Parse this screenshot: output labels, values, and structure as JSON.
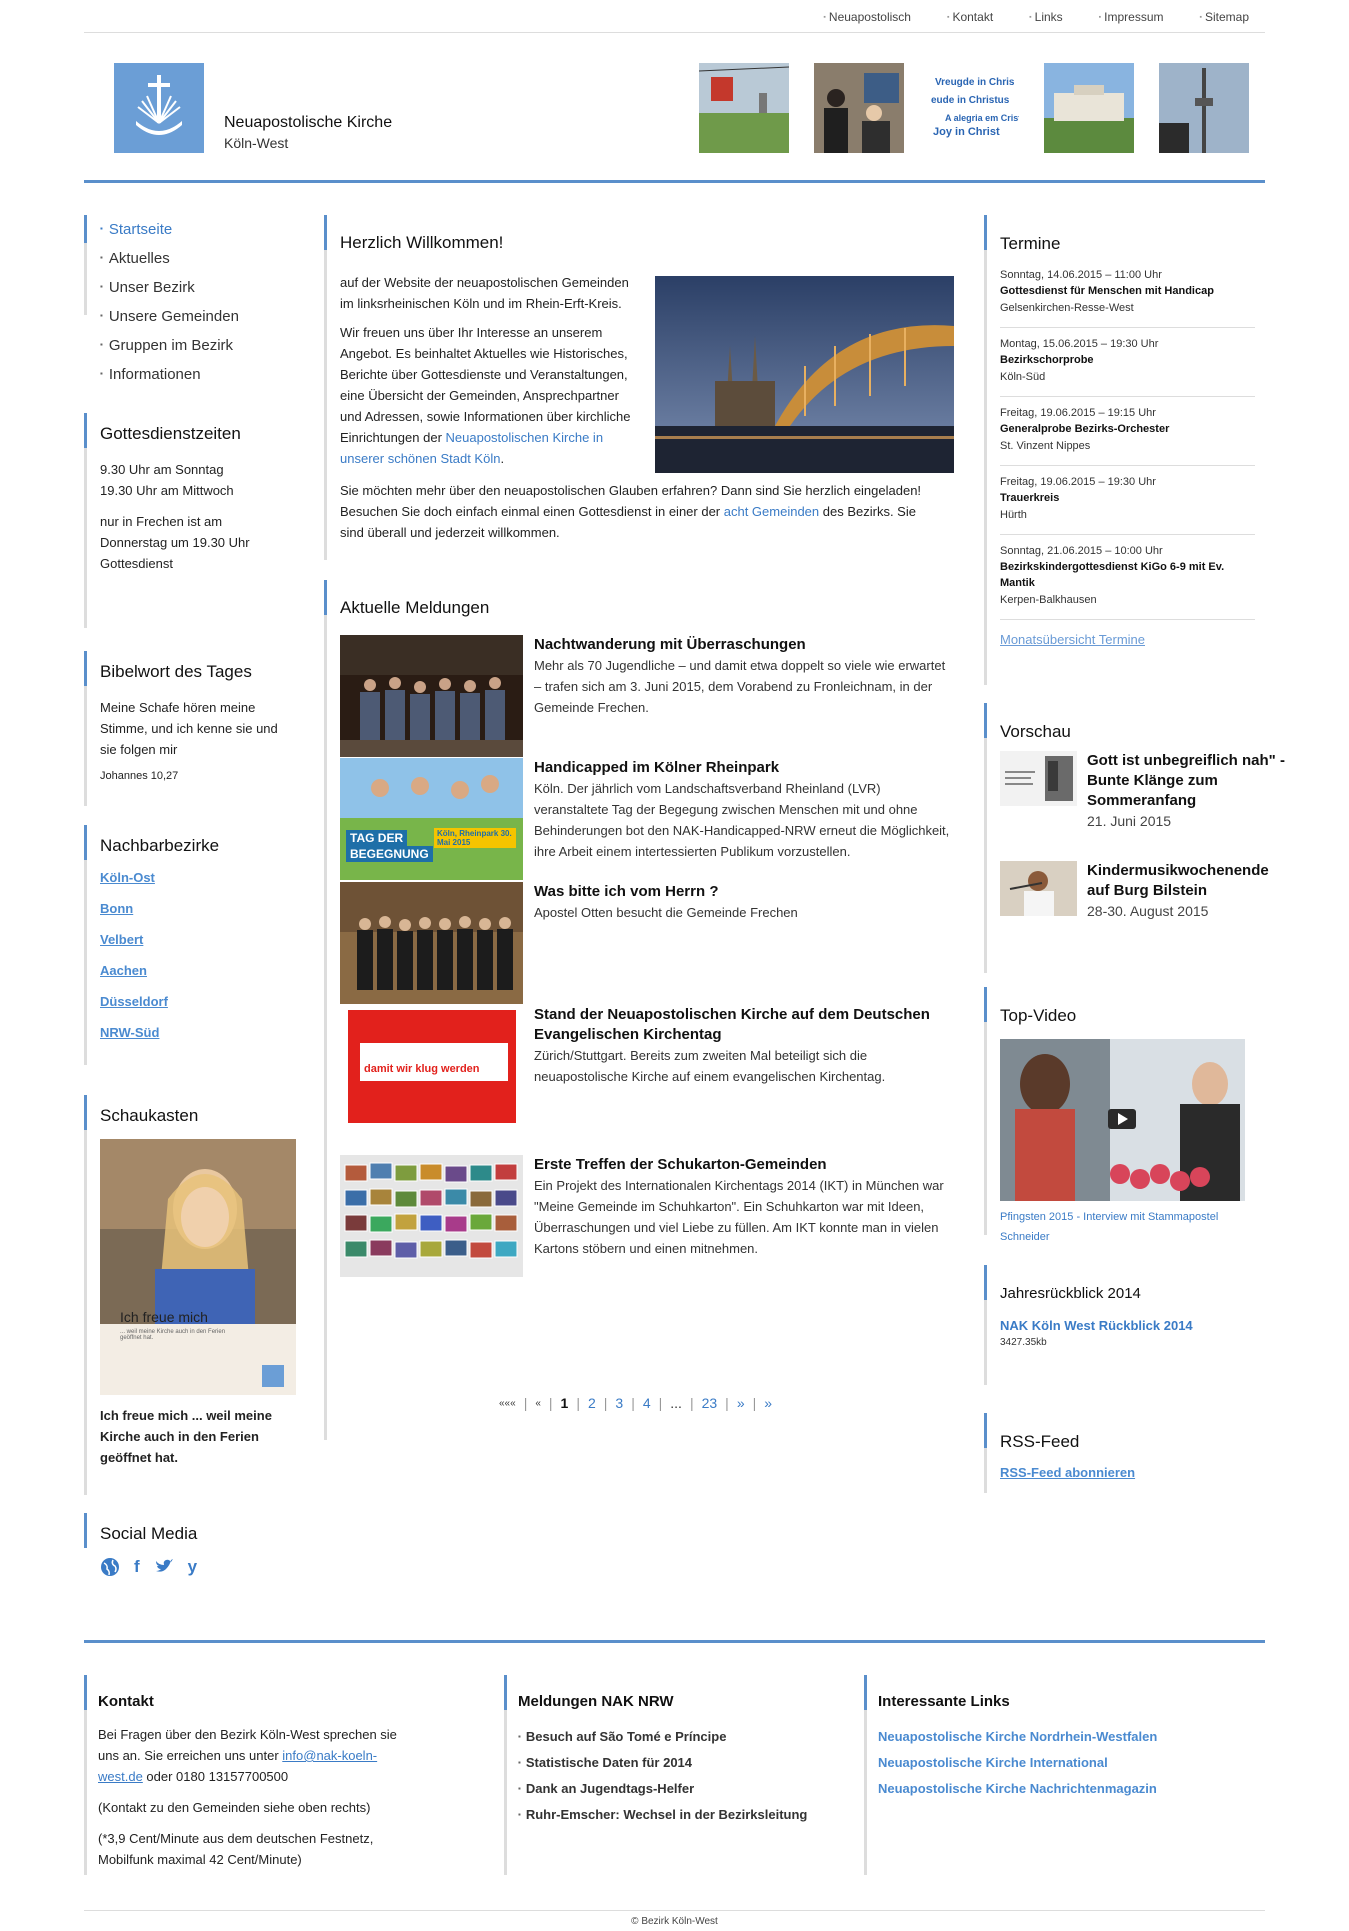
{
  "topnav": [
    "Neuapostolisch",
    "Kontakt",
    "Links",
    "Impressum",
    "Sitemap"
  ],
  "brand": {
    "name": "Neuapostolische Kirche",
    "sub": "Köln-West"
  },
  "header_thumbs": [
    "cable-car",
    "meeting",
    "joy-in-christ",
    "building",
    "tv-tower"
  ],
  "menu": [
    "Startseite",
    "Aktuelles",
    "Unser Bezirk",
    "Unsere Gemeinden",
    "Gruppen im Bezirk",
    "Informationen"
  ],
  "gottesdienst": {
    "title": "Gottesdienstzeiten",
    "lines": [
      "9.30 Uhr am Sonntag",
      "19.30 Uhr am Mittwoch"
    ],
    "note": "nur in Frechen ist am Donnerstag um 19.30 Uhr Gottesdienst"
  },
  "bibelwort": {
    "title": "Bibelwort des Tages",
    "text": "Meine Schafe hören meine Stimme, und ich kenne sie und sie folgen mir",
    "ref": "Johannes 10,27"
  },
  "nachbar": {
    "title": "Nachbarbezirke",
    "links": [
      "Köln-Ost",
      "Bonn",
      "Velbert",
      "Aachen",
      "Düsseldorf",
      "NRW-Süd"
    ]
  },
  "schaukasten": {
    "title": "Schaukasten",
    "poster_text": "Ich freue mich",
    "poster_sub": "... weil meine Kirche auch in den Ferien geöffnet hat.",
    "caption": "Ich freue mich ... weil meine Kirche auch in den Ferien geöffnet hat."
  },
  "social": {
    "title": "Social Media"
  },
  "welcome": {
    "title": "Herzlich Willkommen!",
    "p1": "auf der Website der neuapostolischen Gemeinden im linksrheinischen  Köln und im Rhein-Erft-Kreis.",
    "p2a": "Wir freuen uns über Ihr Interesse an unserem Angebot. Es beinhaltet Aktuelles wie Historisches, Berichte über Gottesdienste und Veranstaltungen, eine Übersicht der Gemeinden, Ansprechpartner und Adressen, sowie Informationen über kirchliche Einrichtungen der ",
    "p2link": "Neuapostolischen Kirche in unserer schönen Stadt Köln",
    "p2end": ".",
    "p3a": "Sie möchten mehr über den neuapostolischen Glauben erfahren? Dann sind Sie herzlich eingeladen! Besuchen Sie doch einfach einmal einen Gottesdienst in einer der ",
    "p3link": "acht Gemeinden",
    "p3end": " des Bezirks. Sie sind überall und jederzeit willkommen."
  },
  "meldungen": {
    "title": "Aktuelle Meldungen",
    "items": [
      {
        "title": "Nachtwanderung mit Überraschungen",
        "text": "Mehr als 70 Jugendliche – und damit etwa doppelt so viele wie erwartet – trafen sich am 3. Juni 2015, dem Vorabend zu Fronleichnam, in der Gemeinde Frechen."
      },
      {
        "title": "Handicapped im Kölner Rheinpark",
        "text": "Köln. Der jährlich vom Landschaftsverband Rheinland (LVR) veranstaltete Tag der Begegung zwischen Menschen mit und ohne Behinderungen bot den NAK-Handicapped-NRW erneut die Möglichkeit, ihre Arbeit einem intertessierten Publikum vorzustellen.",
        "img_text1": "TAG DER",
        "img_text2": "BEGEGNUNG",
        "img_text3": "Köln, Rheinpark 30. Mai 2015"
      },
      {
        "title": "Was bitte ich vom Herrn ?",
        "text": "Apostel Otten besucht die Gemeinde Frechen"
      },
      {
        "title": "Stand der Neuapostolischen Kirche auf dem Deutschen Evangelischen Kirchentag",
        "text": "Zürich/Stuttgart. Bereits zum zweiten Mal beteiligt sich die neuapostolische Kirche auf einem evangelischen Kirchentag.",
        "img_text": "damit wir klug werden"
      },
      {
        "title": "Erste Treffen der Schukarton-Gemeinden",
        "text": "Ein Projekt des Internationalen Kirchentags 2014 (IKT) in München war \"Meine Gemeinde im Schuhkarton\". Ein Schuhkarton war mit Ideen, Überraschungen und viel Liebe zu füllen. Am IKT konnte man in vielen Kartons stöbern und einen mitnehmen."
      }
    ]
  },
  "pager": [
    "«««",
    "«",
    "1",
    "2",
    "3",
    "4",
    "...",
    "23",
    "»",
    "»"
  ],
  "termine": {
    "title": "Termine",
    "events": [
      {
        "date": "Sonntag, 14.06.2015 – 11:00 Uhr",
        "title": "Gottesdienst für Menschen mit Handicap",
        "loc": "Gelsenkirchen-Resse-West"
      },
      {
        "date": "Montag, 15.06.2015 – 19:30 Uhr",
        "title": "Bezirkschorprobe",
        "loc": "Köln-Süd"
      },
      {
        "date": "Freitag, 19.06.2015 – 19:15 Uhr",
        "title": "Generalprobe Bezirks-Orchester",
        "loc": "St. Vinzent Nippes"
      },
      {
        "date": "Freitag, 19.06.2015 – 19:30 Uhr",
        "title": "Trauerkreis",
        "loc": "Hürth"
      },
      {
        "date": "Sonntag, 21.06.2015 – 10:00 Uhr",
        "title": "Bezirkskindergottesdienst KiGo 6-9 mit Ev. Mantik",
        "loc": "Kerpen-Balkhausen"
      }
    ],
    "link": "Monatsübersicht Termine"
  },
  "vorschau": {
    "title": "Vorschau",
    "items": [
      {
        "title": "Gott ist unbegreiflich nah\" - Bunte Klänge zum Sommeranfang",
        "date": "21. Juni 2015"
      },
      {
        "title": "Kindermusikwochenende auf Burg Bilstein",
        "date": "28-30. August 2015"
      }
    ]
  },
  "video": {
    "title": "Top-Video",
    "caption": "Pfingsten 2015 - Interview mit Stammapostel Schneider"
  },
  "jahr": {
    "title": "Jahresrückblick 2014",
    "link": "NAK Köln West Rückblick 2014",
    "size": "3427.35kb"
  },
  "rss": {
    "title": "RSS-Feed",
    "link": "RSS-Feed abonnieren"
  },
  "footer": {
    "kontakt": {
      "title": "Kontakt",
      "p1a": "Bei Fragen über den Bezirk Köln-West sprechen sie uns an. Sie erreichen uns unter ",
      "email": "info@nak-koeln-west.de",
      "p1b": " oder 0180 13157700500",
      "p2": "(Kontakt zu den Gemeinden siehe oben rechts)",
      "p3": "(*3,9 Cent/Minute aus dem deutschen Festnetz, Mobilfunk maximal 42 Cent/Minute)"
    },
    "nrw": {
      "title": "Meldungen NAK NRW",
      "items": [
        "Besuch auf São Tomé e Príncipe",
        "Statistische Daten für 2014",
        "Dank an Jugendtags-Helfer",
        "Ruhr-Emscher: Wechsel in der Bezirksleitung"
      ]
    },
    "links": {
      "title": "Interessante Links",
      "items": [
        "Neuapostolische Kirche Nordrhein-Westfalen",
        "Neuapostolische Kirche International",
        "Neuapostolische Kirche Nachrichtenmagazin"
      ]
    }
  },
  "copyright": "© Bezirk Köln-West",
  "colors": {
    "accent": "#5a8fcb",
    "link": "#3a7bc6"
  }
}
